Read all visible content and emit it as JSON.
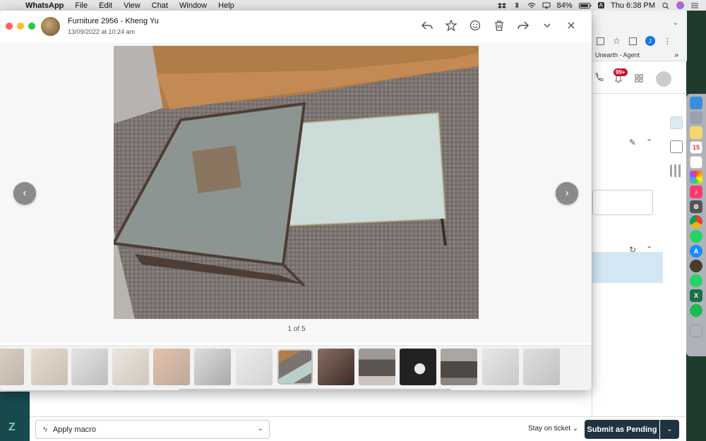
{
  "menubar": {
    "apple": "",
    "app_name": "WhatsApp",
    "items": [
      "File",
      "Edit",
      "View",
      "Chat",
      "Window",
      "Help"
    ],
    "battery": "84%",
    "clock": "Thu 6:38 PM"
  },
  "viewer": {
    "contact_name": "Furniture 2956 - Kheng Yu",
    "date": "13/09/2022 at 10:24 am",
    "counter": "1 of 5",
    "prev_glyph": "‹",
    "next_glyph": "›"
  },
  "chrome": {
    "tab_title": "Unearth - Agent",
    "more_tabs": "»",
    "profile_initial": "J",
    "notifications_badge": "99+"
  },
  "bottom_bar": {
    "macro_label": "Apply macro",
    "stay_on_ticket": "Stay on ticket",
    "submit_label": "Submit as Pending"
  },
  "dock": {
    "calendar_day": "15"
  },
  "colors": {
    "submit_bg": "#1f3440",
    "highlight": "#d4e7f5",
    "badge": "#c8102e"
  }
}
